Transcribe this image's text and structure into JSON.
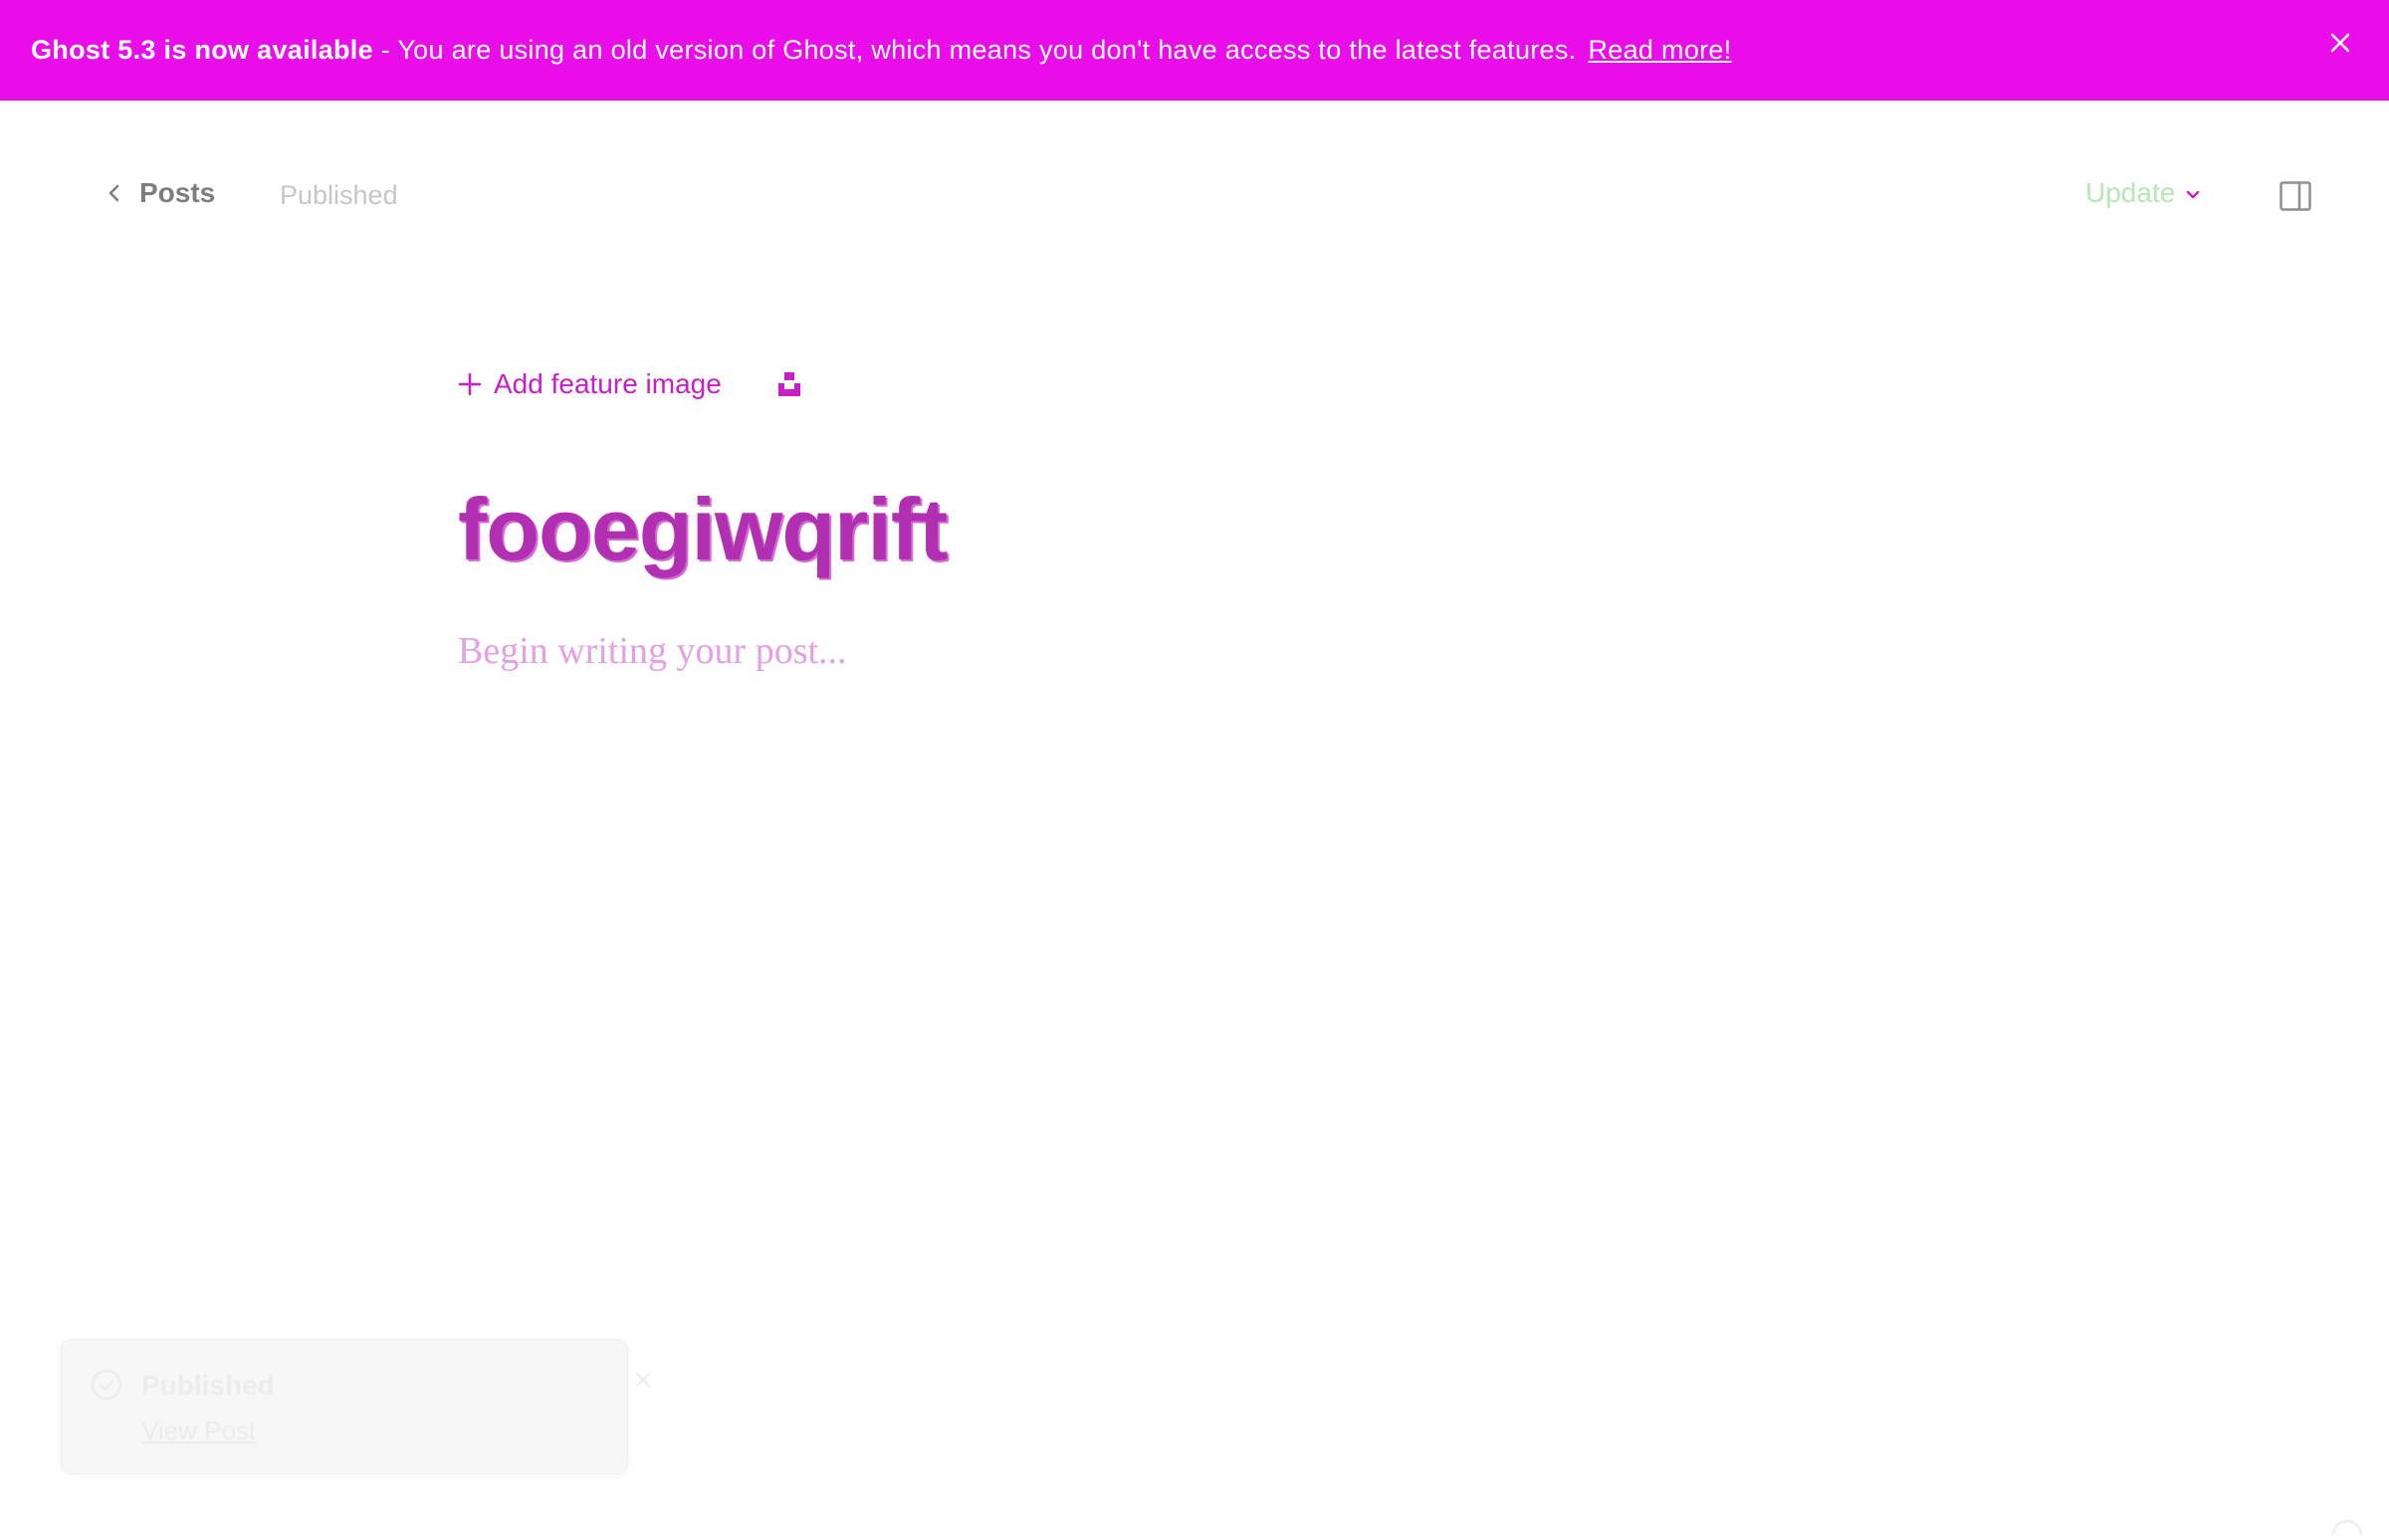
{
  "banner": {
    "version_name": "Ghost 5.3",
    "message_main": " is now available",
    "message_rest": " - You are using an old version of Ghost, which means you don't have access to the latest features.",
    "read_more": "Read more!"
  },
  "header": {
    "back_label": "Posts",
    "status": "Published",
    "update_label": "Update"
  },
  "editor": {
    "add_feature_image": "Add feature image",
    "title": "fooegiwqrift",
    "body_placeholder": "Begin writing your post..."
  },
  "toast": {
    "title": "Published",
    "link": "View Post"
  },
  "colors": {
    "banner": "#e90de9",
    "accent": "#c81ec8",
    "update": "#b7e6b7"
  }
}
